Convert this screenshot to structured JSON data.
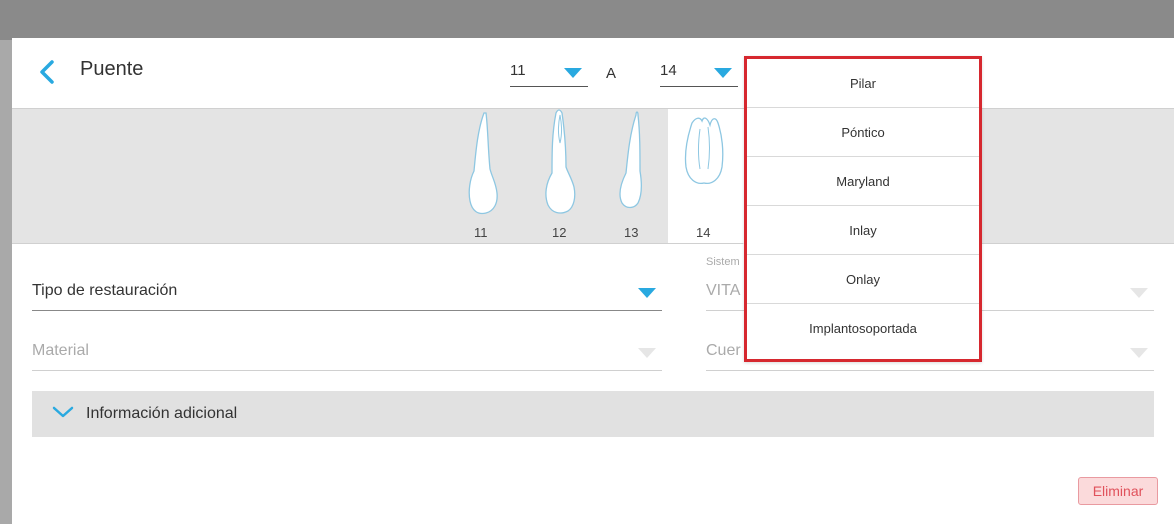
{
  "dialog": {
    "title": "Puente",
    "delete_label": "Eliminar"
  },
  "range": {
    "from": "11",
    "separator": "A",
    "to": "14"
  },
  "teeth": [
    {
      "number": "11"
    },
    {
      "number": "12"
    },
    {
      "number": "13"
    },
    {
      "number": "14"
    }
  ],
  "form": {
    "restoration_type_label": "Tipo de restauración",
    "material_label": "Material",
    "system_small_label": "Sistem",
    "system_value": "VITA",
    "body_label": "Cuer"
  },
  "accordion": {
    "label": "Información adicional"
  },
  "dropdown": {
    "items": [
      "Pilar",
      "Póntico",
      "Maryland",
      "Inlay",
      "Onlay",
      "Implantosoportada"
    ]
  },
  "colors": {
    "accent": "#29a9e0",
    "highlight_border": "#d6282f",
    "delete_text": "#e0515b"
  }
}
